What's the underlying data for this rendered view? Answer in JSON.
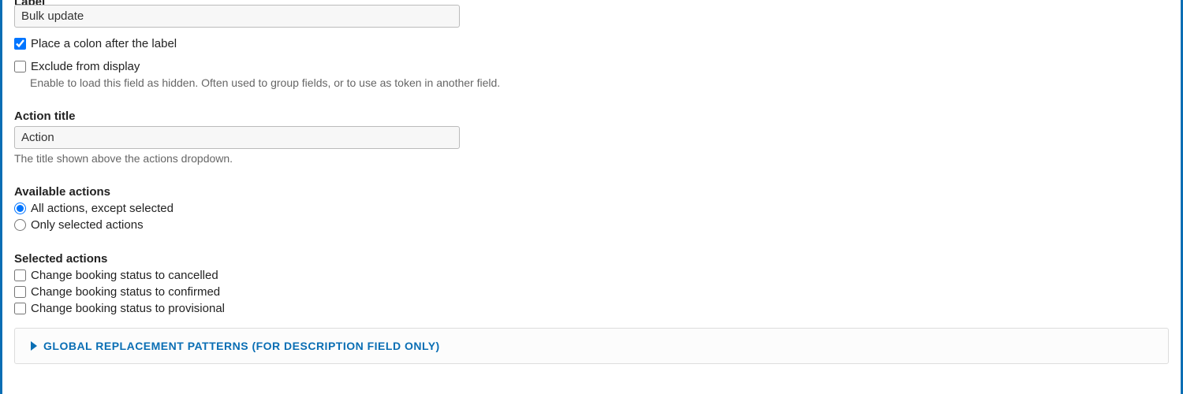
{
  "labelField": {
    "heading": "Label",
    "value": "Bulk update"
  },
  "colonCheckbox": {
    "label": "Place a colon after the label",
    "checked": true
  },
  "excludeCheckbox": {
    "label": "Exclude from display",
    "checked": false,
    "description": "Enable to load this field as hidden. Often used to group fields, or to use as token in another field."
  },
  "actionTitle": {
    "heading": "Action title",
    "value": "Action",
    "help": "The title shown above the actions dropdown."
  },
  "availableActions": {
    "heading": "Available actions",
    "options": [
      {
        "label": "All actions, except selected",
        "selected": true
      },
      {
        "label": "Only selected actions",
        "selected": false
      }
    ]
  },
  "selectedActions": {
    "heading": "Selected actions",
    "items": [
      {
        "label": "Change booking status to cancelled",
        "checked": false
      },
      {
        "label": "Change booking status to confirmed",
        "checked": false
      },
      {
        "label": "Change booking status to provisional",
        "checked": false
      }
    ]
  },
  "details": {
    "title": "GLOBAL REPLACEMENT PATTERNS (FOR DESCRIPTION FIELD ONLY)"
  }
}
